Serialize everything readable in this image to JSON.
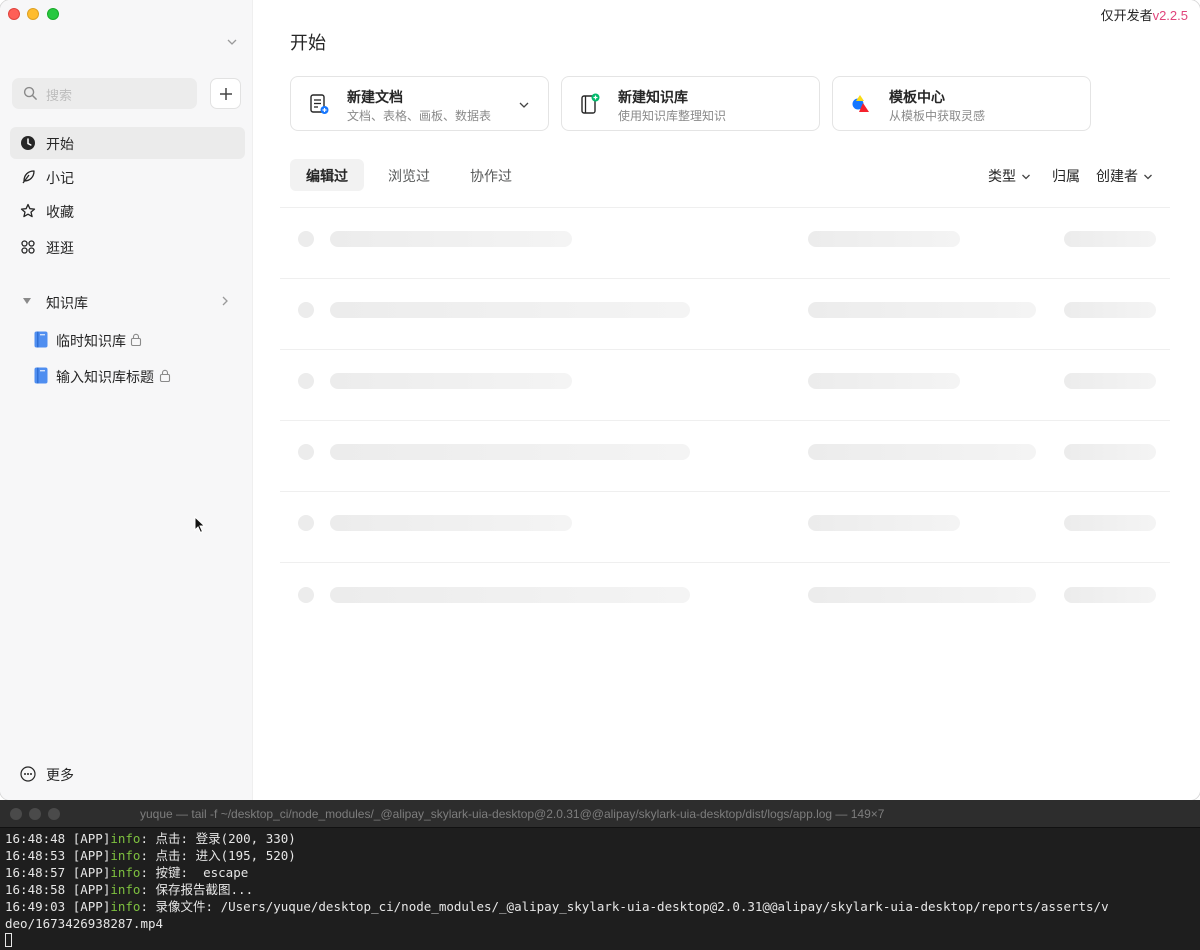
{
  "app": {
    "dev_badge_text": "仅开发者",
    "dev_badge_version": "v2.2.5"
  },
  "sidebar": {
    "search_placeholder": "搜索",
    "nav": [
      {
        "label": "开始",
        "icon": "clock-icon",
        "active": true
      },
      {
        "label": "小记",
        "icon": "feather-icon",
        "active": false
      },
      {
        "label": "收藏",
        "icon": "star-icon",
        "active": false
      },
      {
        "label": "逛逛",
        "icon": "grid-icon",
        "active": false
      }
    ],
    "knowledge_base": {
      "label": "知识库",
      "items": [
        {
          "label": "临时知识库",
          "locked": true
        },
        {
          "label": "输入知识库标题",
          "locked": true
        }
      ]
    },
    "more_label": "更多"
  },
  "main": {
    "title": "开始",
    "quick_actions": [
      {
        "title": "新建文档",
        "subtitle": "文档、表格、画板、数据表",
        "icon": "new-doc-icon",
        "has_dropdown": true
      },
      {
        "title": "新建知识库",
        "subtitle": "使用知识库整理知识",
        "icon": "new-book-icon",
        "has_dropdown": false
      },
      {
        "title": "模板中心",
        "subtitle": "从模板中获取灵感",
        "icon": "template-icon",
        "has_dropdown": false
      }
    ],
    "tabs": [
      {
        "label": "编辑过",
        "active": true
      },
      {
        "label": "浏览过",
        "active": false
      },
      {
        "label": "协作过",
        "active": false
      }
    ],
    "filters": {
      "type": "类型",
      "belongs": "归属",
      "creator": "创建者"
    }
  },
  "terminal": {
    "title": "yuque — tail -f ~/desktop_ci/node_modules/_@alipay_skylark-uia-desktop@2.0.31@@alipay/skylark-uia-desktop/dist/logs/app.log — 149×7",
    "lines": [
      {
        "prefix": "16:48:48 [APP]",
        "level": "info",
        "message": ": 点击: 登录(200, 330)"
      },
      {
        "prefix": "16:48:53 [APP]",
        "level": "info",
        "message": ": 点击: 进入(195, 520)"
      },
      {
        "prefix": "16:48:57 [APP]",
        "level": "info",
        "message": ": 按键:  escape"
      },
      {
        "prefix": "16:48:58 [APP]",
        "level": "info",
        "message": ": 保存报告截图..."
      },
      {
        "prefix": "16:49:03 [APP]",
        "level": "info",
        "message": ": 录像文件: /Users/yuque/desktop_ci/node_modules/_@alipay_skylark-uia-desktop@2.0.31@@alipay/skylark-uia-desktop/reports/asserts/v"
      },
      {
        "prefix": "",
        "level": "",
        "message": "deo/1673426938287.mp4"
      }
    ]
  }
}
